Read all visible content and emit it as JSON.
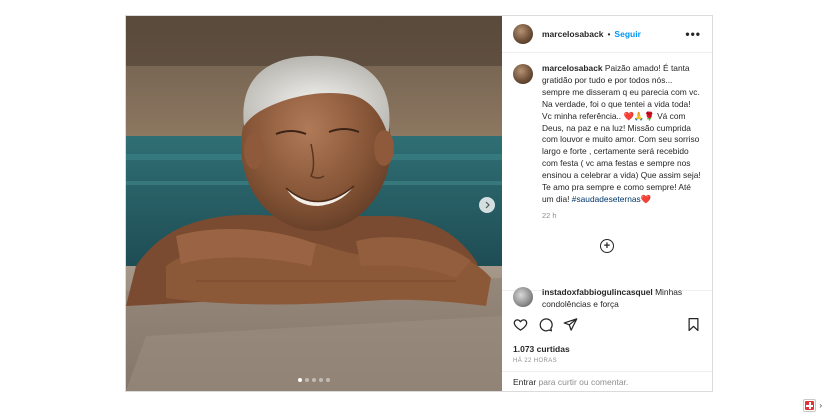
{
  "post": {
    "username": "marcelosaback",
    "separator": "•",
    "follow_label": "Seguir",
    "more_label": "•••",
    "caption": {
      "username": "marcelosaback",
      "text_before": " Paizão amado! É tanta gratidão por tudo e por todos nós... sempre me disseram q eu parecia com vc. Na verdade, foi o que tentei a vida toda! Vc minha referência.. ",
      "emojis_1": "❤️🙏🌹",
      "text_after": " Vá com Deus, na paz e na luz! Missão cumprida com louvor e muito amor. Com seu sorriso largo e forte , certamente será recebido com festa ( vc ama festas e sempre nos ensinou a celebrar a vida) Que assim seja! Te amo pra sempre e como sempre! Até um dia! ",
      "hashtag": "#saudadeseternas",
      "emoji_end": "❤️"
    },
    "caption_time": "22 h",
    "load_more_icon": "plus-circle-icon",
    "comment": {
      "username": "instadoxfabbiogulincasquel",
      "text": " Minhas condolências e força"
    },
    "likes": "1.073 curtidas",
    "time_ago": "HÁ 22 HORAS",
    "add_comment": {
      "enter_label": "Entrar",
      "rest_label": " para curtir ou comentar."
    },
    "carousel": {
      "count": 5,
      "active": 1
    }
  },
  "icons": {
    "like": "heart-icon",
    "comment": "comment-icon",
    "share": "send-icon",
    "save": "bookmark-icon",
    "next": "chevron-right-icon"
  },
  "colors": {
    "accent": "#0095f6",
    "text": "#262626",
    "muted": "#8e8e8e",
    "hashtag": "#00376b"
  }
}
